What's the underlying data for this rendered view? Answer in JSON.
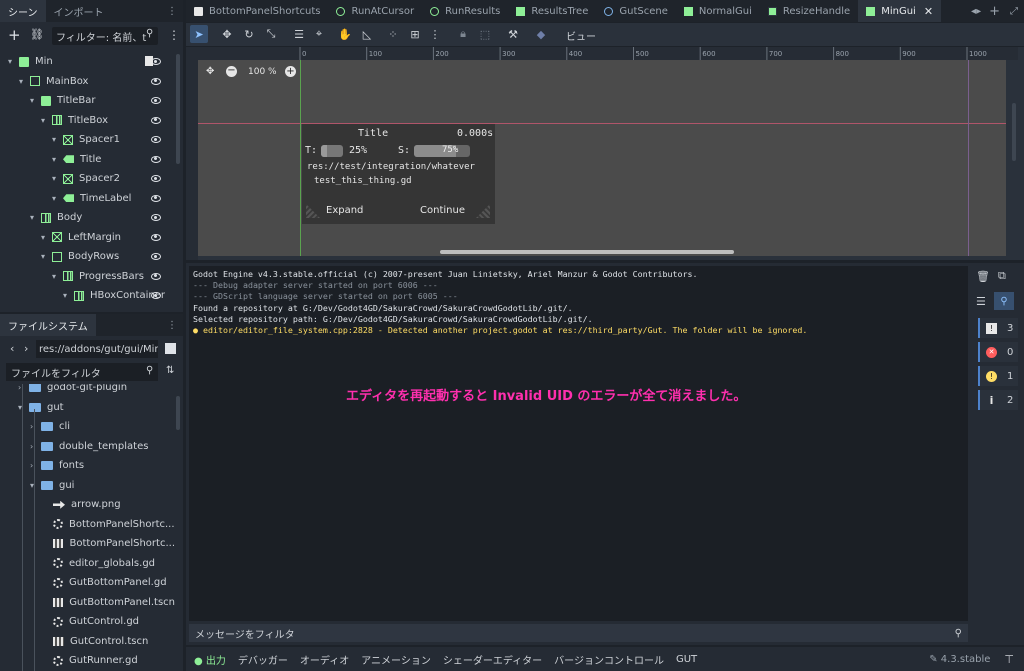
{
  "left_top": {
    "tabs": [
      "シーン",
      "インポート"
    ],
    "filter_placeholder": "フィルター: 名前、t",
    "tree": [
      {
        "label": "Min",
        "icon": "node",
        "depth": 0
      },
      {
        "label": "MainBox",
        "icon": "vbox",
        "depth": 1
      },
      {
        "label": "TitleBar",
        "icon": "node",
        "depth": 2
      },
      {
        "label": "TitleBox",
        "icon": "hbox",
        "depth": 3
      },
      {
        "label": "Spacer1",
        "icon": "spacer",
        "depth": 4
      },
      {
        "label": "Title",
        "icon": "label",
        "depth": 4
      },
      {
        "label": "Spacer2",
        "icon": "spacer",
        "depth": 4
      },
      {
        "label": "TimeLabel",
        "icon": "label",
        "depth": 4
      },
      {
        "label": "Body",
        "icon": "hbox",
        "depth": 2
      },
      {
        "label": "LeftMargin",
        "icon": "spacer",
        "depth": 3
      },
      {
        "label": "BodyRows",
        "icon": "vbox",
        "depth": 3
      },
      {
        "label": "ProgressBars",
        "icon": "hbox",
        "depth": 4
      },
      {
        "label": "HBoxContainer",
        "icon": "hbox",
        "depth": 5
      }
    ]
  },
  "filesystem": {
    "tab": "ファイルシステム",
    "path": "res://addons/gut/gui/Min",
    "filter_placeholder": "ファイルをフィルタ",
    "items": [
      {
        "label": "godot-git-plugin",
        "icon": "folder",
        "depth": 1
      },
      {
        "label": "gut",
        "icon": "folder",
        "depth": 1
      },
      {
        "label": "cli",
        "icon": "folder",
        "depth": 2
      },
      {
        "label": "double_templates",
        "icon": "folder",
        "depth": 2
      },
      {
        "label": "fonts",
        "icon": "folder",
        "depth": 2
      },
      {
        "label": "gui",
        "icon": "folder",
        "depth": 2
      },
      {
        "label": "arrow.png",
        "icon": "arrow",
        "depth": 3
      },
      {
        "label": "BottomPanelShortc...",
        "icon": "gear",
        "depth": 3
      },
      {
        "label": "BottomPanelShortc...",
        "icon": "clap",
        "depth": 3
      },
      {
        "label": "editor_globals.gd",
        "icon": "gear",
        "depth": 3
      },
      {
        "label": "GutBottomPanel.gd",
        "icon": "gear",
        "depth": 3
      },
      {
        "label": "GutBottomPanel.tscn",
        "icon": "clap",
        "depth": 3
      },
      {
        "label": "GutControl.gd",
        "icon": "gear",
        "depth": 3
      },
      {
        "label": "GutControl.tscn",
        "icon": "clap",
        "depth": 3
      },
      {
        "label": "GutRunner.gd",
        "icon": "gear",
        "depth": 3
      }
    ]
  },
  "scene_tabs": [
    "BottomPanelShortcuts",
    "RunAtCursor",
    "RunResults",
    "ResultsTree",
    "GutScene",
    "NormalGui",
    "ResizeHandle",
    "MinGui"
  ],
  "toolbar": {
    "view_label": "ビュー"
  },
  "viewport": {
    "zoom": "100 %",
    "ruler": [
      "0",
      "100",
      "200",
      "300",
      "400",
      "500",
      "600",
      "700",
      "800",
      "900",
      "1000"
    ],
    "gut_panel": {
      "title": "Title",
      "time": "0.000s",
      "t_label": "T:",
      "t_value": "25%",
      "s_label": "S:",
      "s_value": "75%",
      "path": "res://test/integration/whatever",
      "script": "test_this_thing.gd",
      "expand": "Expand",
      "continue": "Continue"
    }
  },
  "output": {
    "lines": [
      "Godot Engine v4.3.stable.official (c) 2007-present Juan Linietsky, Ariel Manzur & Godot Contributors.",
      "--- Debug adapter server started on port 6006 ---",
      "--- GDScript language server started on port 6005 ---",
      "Found a repository at G:/Dev/Godot4GD/SakuraCrowd/SakuraCrowdGodotLib/.git/.",
      "Selected repository path: G:/Dev/Godot4GD/SakuraCrowd/SakuraCrowdGodotLib/.git/."
    ],
    "warning": "editor/editor_file_system.cpp:2828 - Detected another project.godot at res://third_party/Gut. The folder will be ignored.",
    "annotation": "エディタを再起動すると Invalid UID のエラーが全て消えました。",
    "filter_placeholder": "メッセージをフィルタ",
    "counts": {
      "messages": "3",
      "errors": "0",
      "warnings": "1",
      "info": "2"
    }
  },
  "bottom_tabs": [
    "出力",
    "デバッガー",
    "オーディオ",
    "アニメーション",
    "シェーダーエディター",
    "バージョンコントロール",
    "GUT"
  ],
  "version": "4.3.stable",
  "colors": {
    "accent": "#4d82cc",
    "warning": "#ffdd65",
    "annotation": "#ff2fae"
  }
}
